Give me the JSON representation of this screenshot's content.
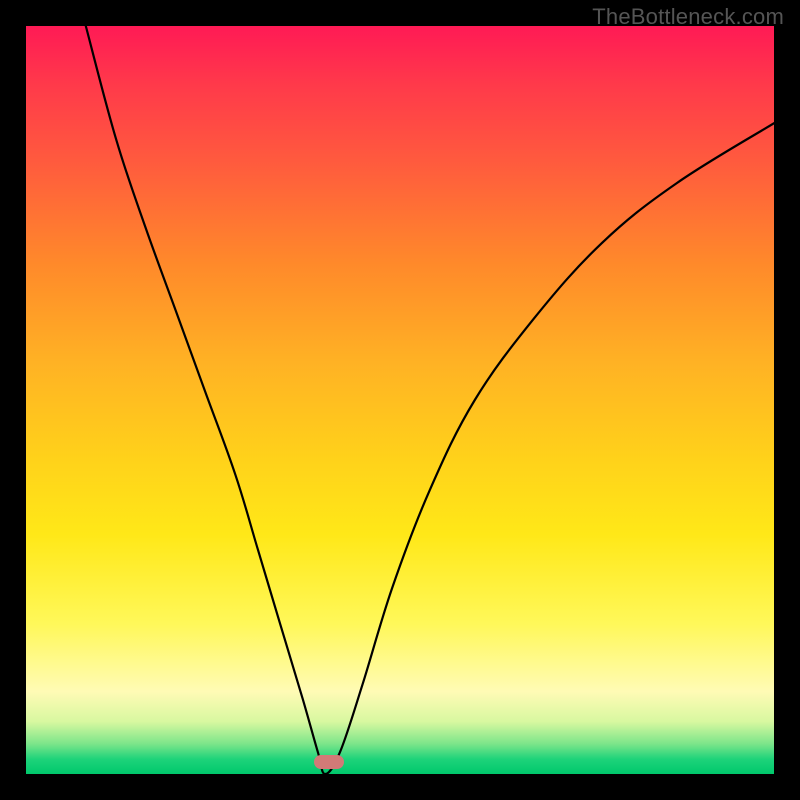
{
  "watermark": "TheBottleneck.com",
  "chart_data": {
    "type": "line",
    "title": "",
    "xlabel": "",
    "ylabel": "",
    "xlim": [
      0,
      1
    ],
    "ylim": [
      0,
      1
    ],
    "background_gradient": [
      {
        "stop": 0.0,
        "color": "#ff1a55"
      },
      {
        "stop": 0.2,
        "color": "#ff5a3e"
      },
      {
        "stop": 0.45,
        "color": "#ffb224"
      },
      {
        "stop": 0.7,
        "color": "#ffe818"
      },
      {
        "stop": 0.9,
        "color": "#fffbb5"
      },
      {
        "stop": 0.97,
        "color": "#7be58a"
      },
      {
        "stop": 1.0,
        "color": "#00c86c"
      }
    ],
    "curve": {
      "minimum_x": 0.4,
      "minimum_y": 0.0,
      "left_branch": [
        {
          "x": 0.08,
          "y": 1.0
        },
        {
          "x": 0.12,
          "y": 0.85
        },
        {
          "x": 0.16,
          "y": 0.73
        },
        {
          "x": 0.2,
          "y": 0.62
        },
        {
          "x": 0.24,
          "y": 0.51
        },
        {
          "x": 0.28,
          "y": 0.4
        },
        {
          "x": 0.31,
          "y": 0.3
        },
        {
          "x": 0.34,
          "y": 0.2
        },
        {
          "x": 0.37,
          "y": 0.1
        },
        {
          "x": 0.39,
          "y": 0.03
        },
        {
          "x": 0.4,
          "y": 0.0
        }
      ],
      "right_branch": [
        {
          "x": 0.4,
          "y": 0.0
        },
        {
          "x": 0.42,
          "y": 0.03
        },
        {
          "x": 0.45,
          "y": 0.12
        },
        {
          "x": 0.49,
          "y": 0.25
        },
        {
          "x": 0.54,
          "y": 0.38
        },
        {
          "x": 0.6,
          "y": 0.5
        },
        {
          "x": 0.68,
          "y": 0.61
        },
        {
          "x": 0.77,
          "y": 0.71
        },
        {
          "x": 0.87,
          "y": 0.79
        },
        {
          "x": 1.0,
          "y": 0.87
        }
      ]
    },
    "marker": {
      "x": 0.405,
      "y": 0.016,
      "color": "#d27a77"
    }
  }
}
